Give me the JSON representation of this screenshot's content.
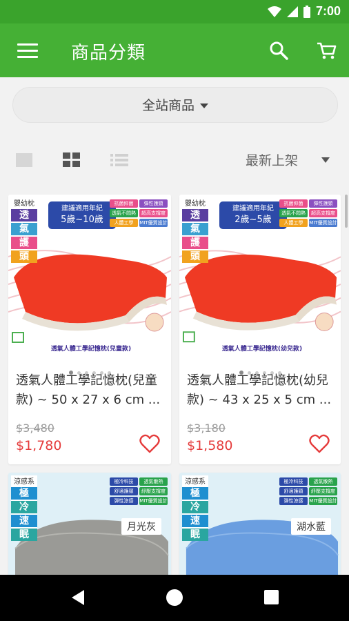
{
  "status_bar": {
    "time": "7:00"
  },
  "app_bar": {
    "title": "商品分類"
  },
  "category": {
    "selected": "全站商品"
  },
  "sort": {
    "selected": "最新上架"
  },
  "products": [
    {
      "title": "透氣人體工學記憶枕(兒童款) ~ 50 x 27 x 6 cm ...",
      "original_price": "$3,480",
      "sale_price": "$1,780",
      "image": {
        "badge_top": "嬰幼枕",
        "badge_main": [
          "透",
          "氣",
          "護",
          "頭"
        ],
        "age_label": "建議適用年紀",
        "age": "5歲~10歲",
        "pillow_color": "#ef3a24",
        "banner": "透氣人體工學記憶枕(兒童款)"
      },
      "dots": 6
    },
    {
      "title": "透氣人體工學記憶枕(幼兒款) ~ 43 x 25 x 5 cm ...",
      "original_price": "$3,180",
      "sale_price": "$1,580",
      "image": {
        "badge_top": "嬰幼枕",
        "badge_main": [
          "透",
          "氣",
          "護",
          "頭"
        ],
        "age_label": "建議適用年紀",
        "age": "2歲~5歲",
        "pillow_color": "#ef3a24",
        "banner": "透氣人體工學記憶枕(幼兒款)"
      },
      "dots": 6
    },
    {
      "image": {
        "badge_top": "涼感系",
        "badge_main": [
          "極",
          "冷",
          "速",
          "眠"
        ],
        "pillow_color": "#9a9a96",
        "color_name": "月光灰"
      }
    },
    {
      "image": {
        "badge_top": "涼感系",
        "badge_main": [
          "極",
          "冷",
          "速",
          "眠"
        ],
        "pillow_color": "#6a9ee0",
        "color_name": "湖水藍"
      }
    }
  ],
  "features": [
    "抗菌抑菌",
    "彈性護頸",
    "透氣不悶熱",
    "超高支撐度",
    "人體工學",
    "MIT優質設計"
  ],
  "features_cool": [
    "極冷科技",
    "透氣散熱",
    "舒適護頸",
    "紓壓支撐度",
    "彈性涼感",
    "MIT優質設計"
  ],
  "colors": {
    "green": "#45b035",
    "price_red": "#e53b3b"
  }
}
